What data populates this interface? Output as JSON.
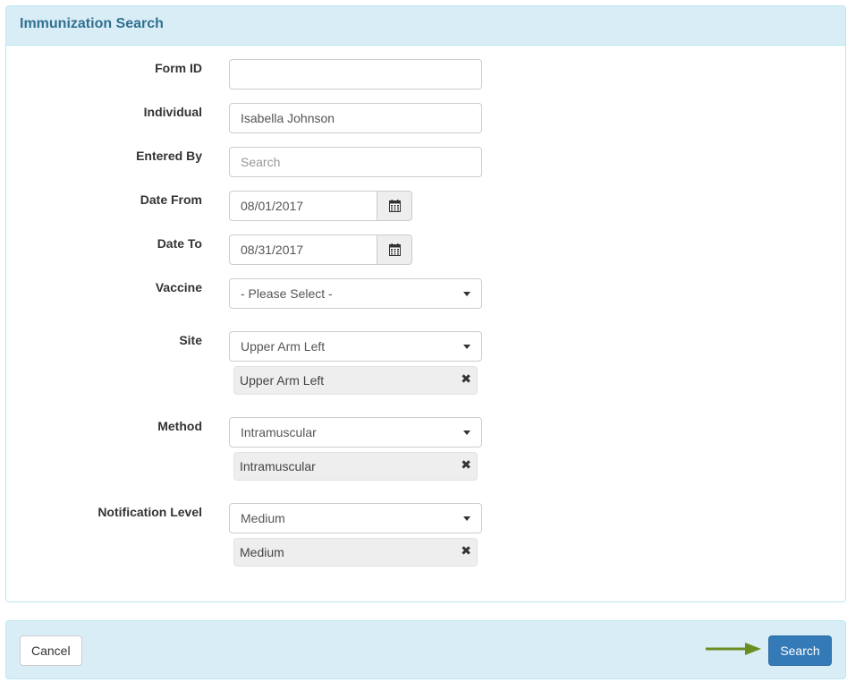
{
  "panel": {
    "title": "Immunization Search"
  },
  "form": {
    "form_id": {
      "label": "Form ID",
      "value": "",
      "placeholder": ""
    },
    "individual": {
      "label": "Individual",
      "value": "Isabella Johnson"
    },
    "entered_by": {
      "label": "Entered By",
      "value": "",
      "placeholder": "Search"
    },
    "date_from": {
      "label": "Date From",
      "value": "08/01/2017"
    },
    "date_to": {
      "label": "Date To",
      "value": "08/31/2017"
    },
    "vaccine": {
      "label": "Vaccine",
      "selected": "- Please Select -"
    },
    "site": {
      "label": "Site",
      "selected": "Upper Arm Left",
      "chips": [
        "Upper Arm Left"
      ]
    },
    "method": {
      "label": "Method",
      "selected": "Intramuscular",
      "chips": [
        "Intramuscular"
      ]
    },
    "notification_level": {
      "label": "Notification Level",
      "selected": "Medium",
      "chips": [
        "Medium"
      ]
    }
  },
  "footer": {
    "cancel_label": "Cancel",
    "search_label": "Search"
  },
  "icons": {
    "calendar": "calendar-icon",
    "caret": "caret-down-icon",
    "remove": "remove-icon",
    "arrow": "arrow-right-icon"
  },
  "colors": {
    "heading_bg": "#d9edf7",
    "heading_text": "#31708f",
    "primary": "#337ab7",
    "arrow": "#6b8e23"
  }
}
